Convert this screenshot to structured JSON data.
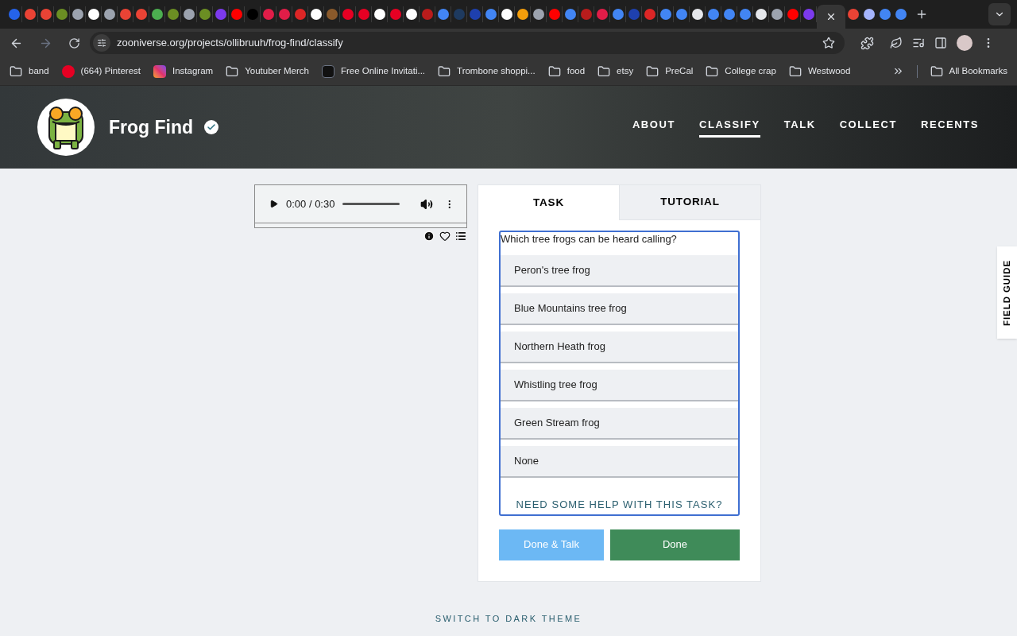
{
  "browser": {
    "url": "zooniverse.org/projects/ollibruuh/frog-find/classify",
    "bookmarks": [
      {
        "label": "band",
        "kind": "folder"
      },
      {
        "label": "(664) Pinterest",
        "kind": "pinterest"
      },
      {
        "label": "Instagram",
        "kind": "instagram"
      },
      {
        "label": "Youtuber Merch",
        "kind": "folder"
      },
      {
        "label": "Free Online Invitati...",
        "kind": "site"
      },
      {
        "label": "Trombone shoppi...",
        "kind": "folder"
      },
      {
        "label": "food",
        "kind": "folder"
      },
      {
        "label": "etsy",
        "kind": "folder"
      },
      {
        "label": "PreCal",
        "kind": "folder"
      },
      {
        "label": "College crap",
        "kind": "folder"
      },
      {
        "label": "Westwood",
        "kind": "folder"
      }
    ],
    "all_bookmarks": "All Bookmarks"
  },
  "project": {
    "title": "Frog Find",
    "nav": [
      {
        "label": "ABOUT",
        "selected": false
      },
      {
        "label": "CLASSIFY",
        "selected": true
      },
      {
        "label": "TALK",
        "selected": false
      },
      {
        "label": "COLLECT",
        "selected": false
      },
      {
        "label": "RECENTS",
        "selected": false
      }
    ]
  },
  "player": {
    "time": "0:00 / 0:30"
  },
  "panel": {
    "tabs": [
      {
        "label": "TASK",
        "selected": true
      },
      {
        "label": "TUTORIAL",
        "selected": false
      }
    ],
    "question": "Which tree frogs can be heard calling?",
    "answers": [
      "Peron's tree frog",
      "Blue Mountains tree frog",
      "Northern Heath frog",
      "Whistling tree frog",
      "Green Stream frog",
      "None"
    ],
    "help": "NEED SOME HELP WITH THIS TASK?",
    "buttons": [
      {
        "label": "Done & Talk",
        "kind": "secondary"
      },
      {
        "label": "Done",
        "kind": "primary"
      }
    ]
  },
  "field_guide": "FIELD GUIDE",
  "theme_link": "SWITCH TO DARK THEME"
}
